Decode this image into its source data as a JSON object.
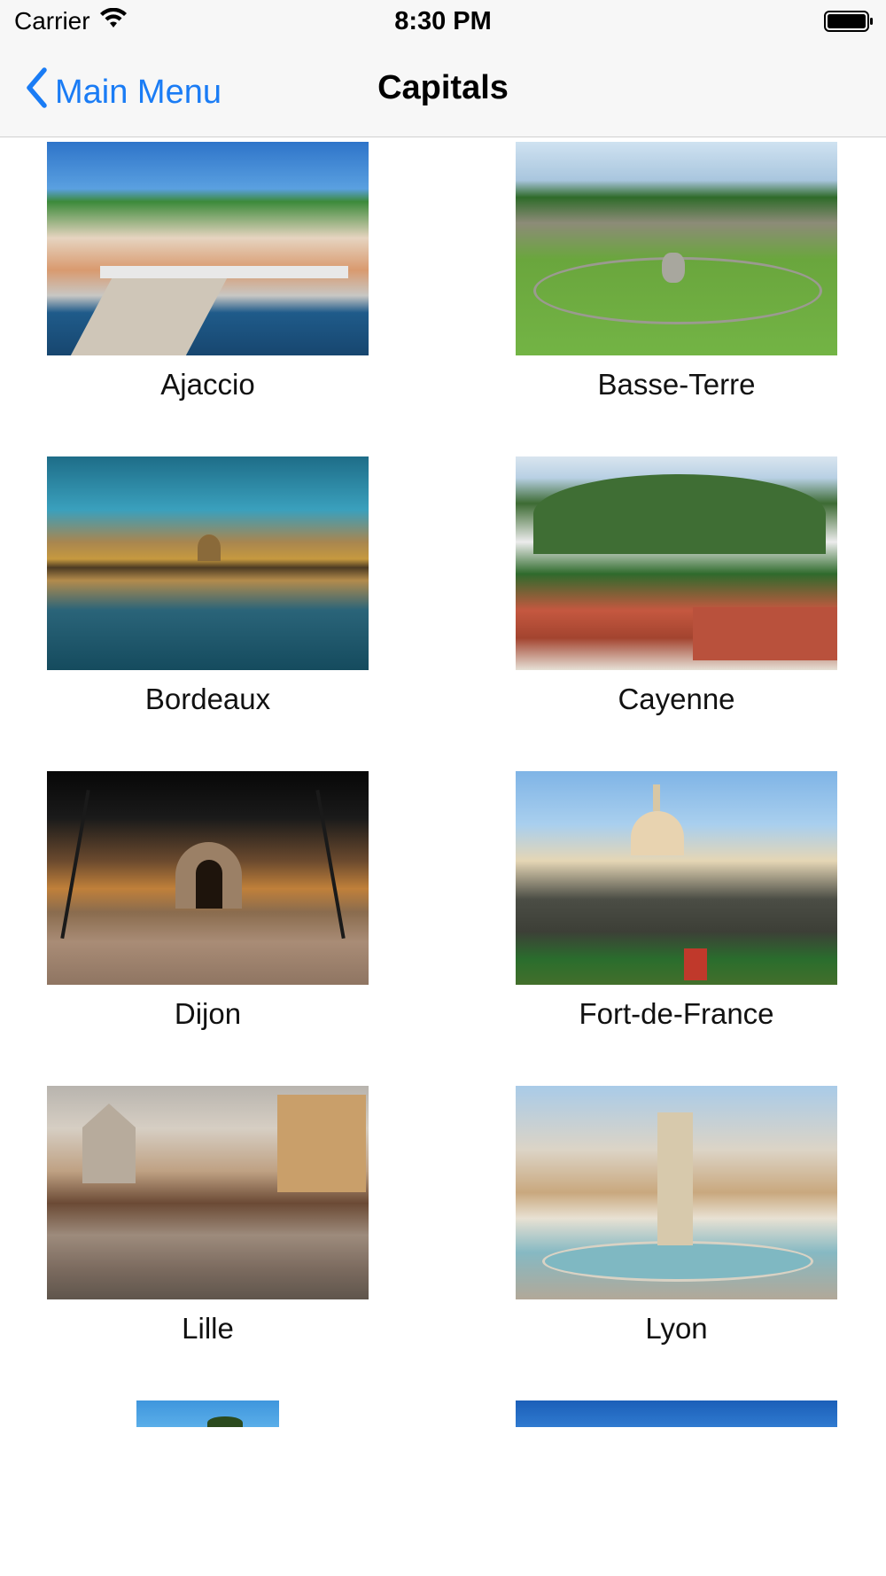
{
  "status_bar": {
    "carrier": "Carrier",
    "time": "8:30 PM"
  },
  "nav": {
    "back_label": "Main Menu",
    "title": "Capitals"
  },
  "capitals": [
    {
      "name": "Ajaccio"
    },
    {
      "name": "Basse-Terre"
    },
    {
      "name": "Bordeaux"
    },
    {
      "name": "Cayenne"
    },
    {
      "name": "Dijon"
    },
    {
      "name": "Fort-de-France"
    },
    {
      "name": "Lille"
    },
    {
      "name": "Lyon"
    }
  ],
  "colors": {
    "accent": "#1a7cf5",
    "bar_background": "#f7f7f7"
  },
  "icons": {
    "back": "chevron-left-icon",
    "wifi": "wifi-icon",
    "battery": "battery-icon"
  }
}
